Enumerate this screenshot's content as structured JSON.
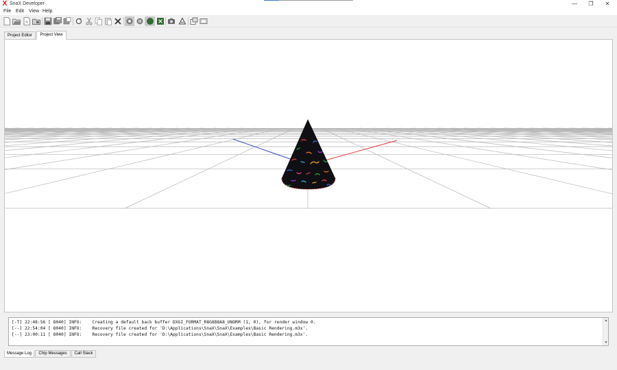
{
  "window": {
    "title": "SnaX Developer",
    "logo_glyph": "X",
    "minimize_glyph": "—",
    "restore_glyph": "❐",
    "close_glyph": "✕"
  },
  "menu": [
    "File",
    "Edit",
    "View",
    "Help"
  ],
  "toolbar": {
    "buttons": [
      "new-file-icon",
      "open-folder-icon",
      "new-document-icon",
      "open-project-icon",
      "save-icon",
      "save-all-icon",
      "save-copy-icon",
      "refresh-icon",
      "cut-icon",
      "copy-icon",
      "paste-icon",
      "delete-icon",
      "record-icon",
      "pause-icon",
      "run-icon",
      "stop-icon",
      "camera-icon",
      "geometry-icon",
      "windows-icon",
      "fullscreen-icon"
    ]
  },
  "tabs": {
    "items": [
      "Project Editor",
      "Project View"
    ],
    "active": "Project View"
  },
  "viewport": {
    "background": "#ffffff",
    "grid_color": "#b5b5b5",
    "cone_color": "#0f0f14",
    "axis_x_color": "#e8383a",
    "axis_z_color": "#3b4bd6"
  },
  "log": {
    "lines": [
      "[-T] 22:48:56 [ 8040] INFO:    Creating a default back buffer DXGI_FORMAT_R8G8B8A8_UNORM (1, 0), for render window 0.",
      "[--] 22:54:04 [ 8040] INFO:    Recovery file created for 'D:\\Applications\\SnaX\\SnaX\\Examples\\Basic Rendering.m3x'.",
      "[--] 23:00:11 [ 8040] INFO:    Recovery file created for 'D:\\Applications\\SnaX\\SnaX\\Examples\\Basic Rendering.m3x'."
    ],
    "scroll_up": "▲",
    "scroll_down": "▼"
  },
  "bottom_tabs": {
    "items": [
      "Message Log",
      "Chip Messages",
      "Call Stack"
    ],
    "active": "Message Log"
  }
}
